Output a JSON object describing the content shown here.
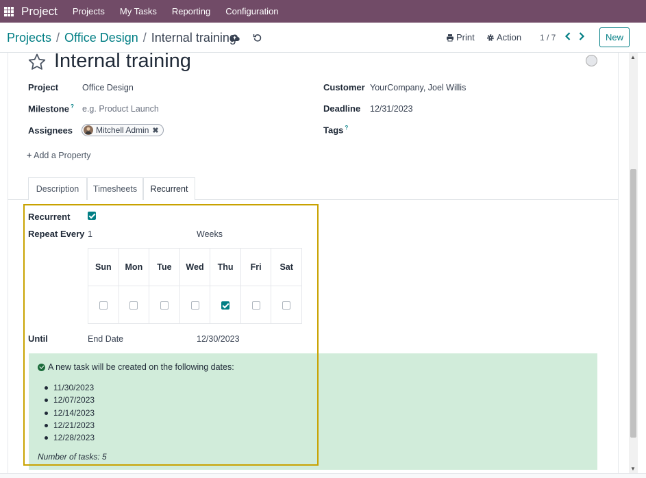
{
  "topbar": {
    "app_name": "Project",
    "menu": [
      "Projects",
      "My Tasks",
      "Reporting",
      "Configuration"
    ]
  },
  "breadcrumb": {
    "items": [
      "Projects",
      "Office Design"
    ],
    "current": "Internal training",
    "separator": "/"
  },
  "actions": {
    "print_label": "Print",
    "action_label": "Action",
    "pager": "1 / 7",
    "new_label": "New"
  },
  "task": {
    "title": "Internal training",
    "fields": {
      "project_label": "Project",
      "project_value": "Office Design",
      "milestone_label": "Milestone",
      "milestone_placeholder": "e.g. Product Launch",
      "assignees_label": "Assignees",
      "assignee": "Mitchell Admin",
      "customer_label": "Customer",
      "customer_value": "YourCompany, Joel Willis",
      "deadline_label": "Deadline",
      "deadline_value": "12/31/2023",
      "tags_label": "Tags",
      "help_mark": "?"
    },
    "add_property": "Add a Property"
  },
  "tabs": [
    {
      "label": "Description",
      "active": false
    },
    {
      "label": "Timesheets",
      "active": false
    },
    {
      "label": "Recurrent",
      "active": true
    }
  ],
  "recurrence": {
    "recurrent_label": "Recurrent",
    "recurrent_checked": true,
    "repeat_label": "Repeat Every",
    "repeat_value": "1",
    "repeat_unit": "Weeks",
    "days": [
      {
        "name": "Sun",
        "checked": false
      },
      {
        "name": "Mon",
        "checked": false
      },
      {
        "name": "Tue",
        "checked": false
      },
      {
        "name": "Wed",
        "checked": false
      },
      {
        "name": "Thu",
        "checked": true
      },
      {
        "name": "Fri",
        "checked": false
      },
      {
        "name": "Sat",
        "checked": false
      }
    ],
    "until_label": "Until",
    "until_type": "End Date",
    "until_date": "12/30/2023",
    "info_heading": "A new task will be created on the following dates:",
    "dates": [
      "11/30/2023",
      "12/07/2023",
      "12/14/2023",
      "12/21/2023",
      "12/28/2023"
    ],
    "num_tasks": "Number of tasks: 5"
  },
  "colors": {
    "nav": "#714b67",
    "accent": "#017e84",
    "info_bg": "#d1ecda",
    "highlight": "#c8a200"
  }
}
